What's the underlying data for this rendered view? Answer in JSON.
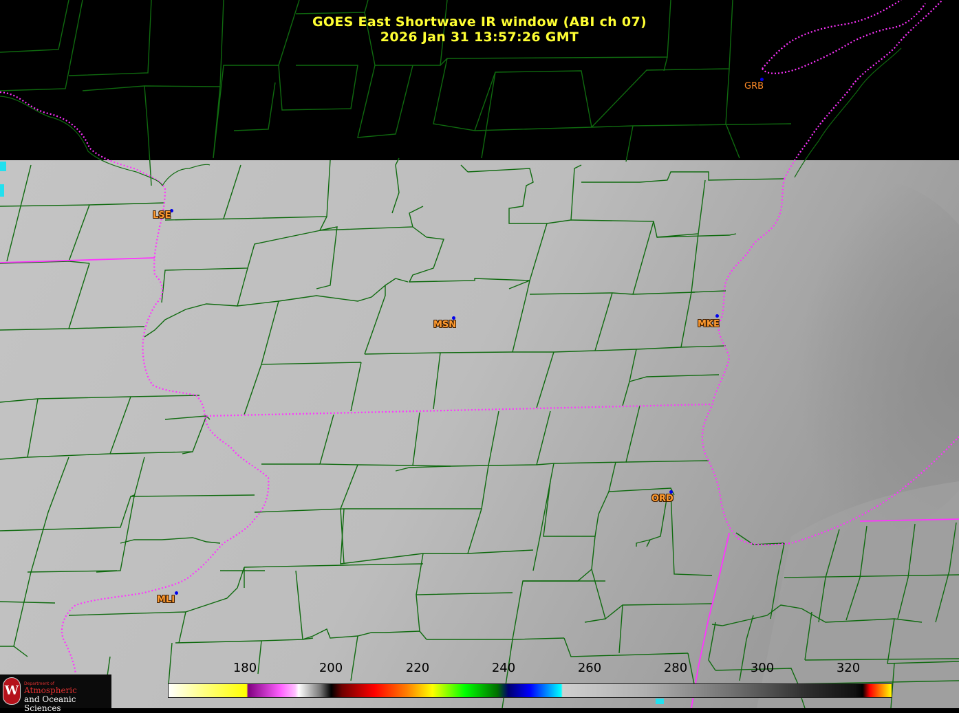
{
  "title": {
    "line1": "GOES East Shortwave IR window (ABI ch 07)",
    "line2": "2026 Jan 31  13:57:26 GMT"
  },
  "stations": [
    {
      "code": "GRB"
    },
    {
      "code": "LSE"
    },
    {
      "code": "MSN"
    },
    {
      "code": "MKE"
    },
    {
      "code": "ORD"
    },
    {
      "code": "MLI"
    }
  ],
  "colorbar": {
    "ticks": [
      "180",
      "200",
      "220",
      "240",
      "260",
      "280",
      "300",
      "320"
    ],
    "range": [
      162,
      330
    ]
  },
  "logo": {
    "seal": "W",
    "dept": "Department of",
    "line1": "Atmospheric",
    "line2": "and Oceanic Sciences"
  },
  "colors": {
    "title": "#ffff33",
    "county_lines": "#0f6a0f",
    "state_lines": "#ff33ff",
    "station_label": "#ff9b30",
    "station_dot": "#0000ee",
    "background": "#000000"
  }
}
